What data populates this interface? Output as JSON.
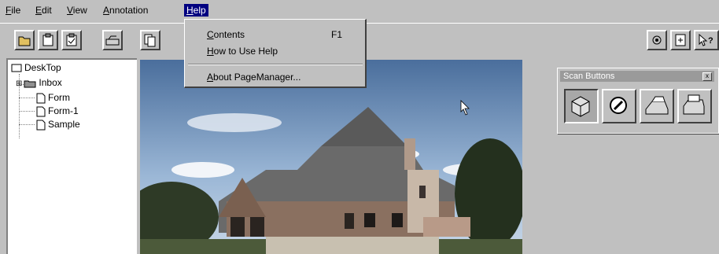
{
  "menubar": {
    "items": [
      {
        "label": "File",
        "key": "F",
        "rest": "ile"
      },
      {
        "label": "Edit",
        "key": "E",
        "rest": "dit"
      },
      {
        "label": "View",
        "key": "V",
        "rest": "iew"
      },
      {
        "label": "Annotation",
        "key": "A",
        "rest": "nnotation"
      },
      {
        "label": "Help",
        "key": "H",
        "rest": "elp"
      }
    ],
    "active": "Help"
  },
  "help_menu": {
    "items": [
      {
        "label": "Contents",
        "key": "C",
        "rest": "ontents",
        "shortcut": "F1"
      },
      {
        "label": "How to Use Help",
        "key": "H",
        "rest": "ow to Use Help",
        "shortcut": ""
      },
      {
        "label": "About PageManager...",
        "key": "A",
        "rest": "bout PageManager...",
        "shortcut": ""
      }
    ]
  },
  "tree": {
    "root": "DeskTop",
    "items": [
      "Inbox",
      "Form",
      "Form-1",
      "Sample"
    ],
    "expander": "⊞"
  },
  "scan_panel": {
    "title": "Scan Buttons",
    "close": "x"
  },
  "colors": {
    "menu_highlight": "#000080",
    "chrome": "#c0c0c0"
  },
  "icons": [
    "folder-icon",
    "clipboard-icon",
    "clipboard-check-icon",
    "scanner-icon",
    "copy-pages-icon",
    "settings-icon",
    "page-icon",
    "help-pointer-icon"
  ]
}
